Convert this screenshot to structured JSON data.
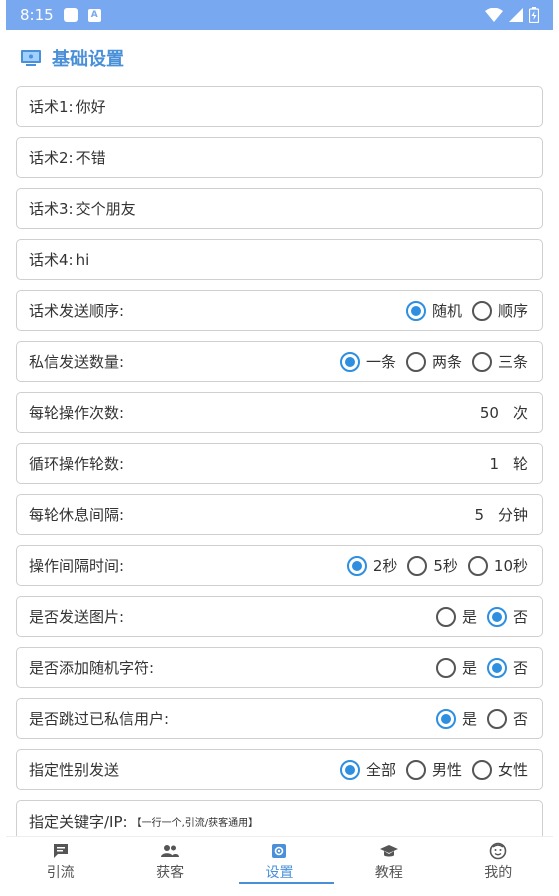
{
  "status_bar": {
    "time": "8:15"
  },
  "section": {
    "title": "基础设置"
  },
  "scripts": [
    {
      "label": "话术1:",
      "value": "你好"
    },
    {
      "label": "话术2:",
      "value": "不错"
    },
    {
      "label": "话术3:",
      "value": "交个朋友"
    },
    {
      "label": "话术4:",
      "value": "hi"
    }
  ],
  "send_order": {
    "label": "话术发送顺序:",
    "options": [
      "随机",
      "顺序"
    ],
    "selected": "随机"
  },
  "dm_count": {
    "label": "私信发送数量:",
    "options": [
      "一条",
      "两条",
      "三条"
    ],
    "selected": "一条"
  },
  "ops_per_round": {
    "label": "每轮操作次数:",
    "value": "50",
    "unit": "次"
  },
  "loop_rounds": {
    "label": "循环操作轮数:",
    "value": "1",
    "unit": "轮"
  },
  "rest_interval": {
    "label": "每轮休息间隔:",
    "value": "5",
    "unit": "分钟"
  },
  "op_interval": {
    "label": "操作间隔时间:",
    "options": [
      "2秒",
      "5秒",
      "10秒"
    ],
    "selected": "2秒"
  },
  "send_image": {
    "label": "是否发送图片:",
    "options": [
      "是",
      "否"
    ],
    "selected": "否"
  },
  "random_chars": {
    "label": "是否添加随机字符:",
    "options": [
      "是",
      "否"
    ],
    "selected": "否"
  },
  "skip_dm_users": {
    "label": "是否跳过已私信用户:",
    "options": [
      "是",
      "否"
    ],
    "selected": "是"
  },
  "gender": {
    "label": "指定性别发送",
    "options": [
      "全部",
      "男性",
      "女性"
    ],
    "selected": "全部"
  },
  "keyword": {
    "label": "指定关键字/IP:",
    "hint": "【一行一个,引流/获客通用】"
  },
  "tabs": [
    {
      "label": "引流",
      "icon": "chat-icon"
    },
    {
      "label": "获客",
      "icon": "people-icon"
    },
    {
      "label": "设置",
      "icon": "settings-icon",
      "active": true
    },
    {
      "label": "教程",
      "icon": "graduation-cap-icon"
    },
    {
      "label": "我的",
      "icon": "face-icon"
    }
  ],
  "colors": {
    "status_bar": "#78a8f0",
    "accent": "#2e8fe0",
    "title": "#4a90d9"
  }
}
